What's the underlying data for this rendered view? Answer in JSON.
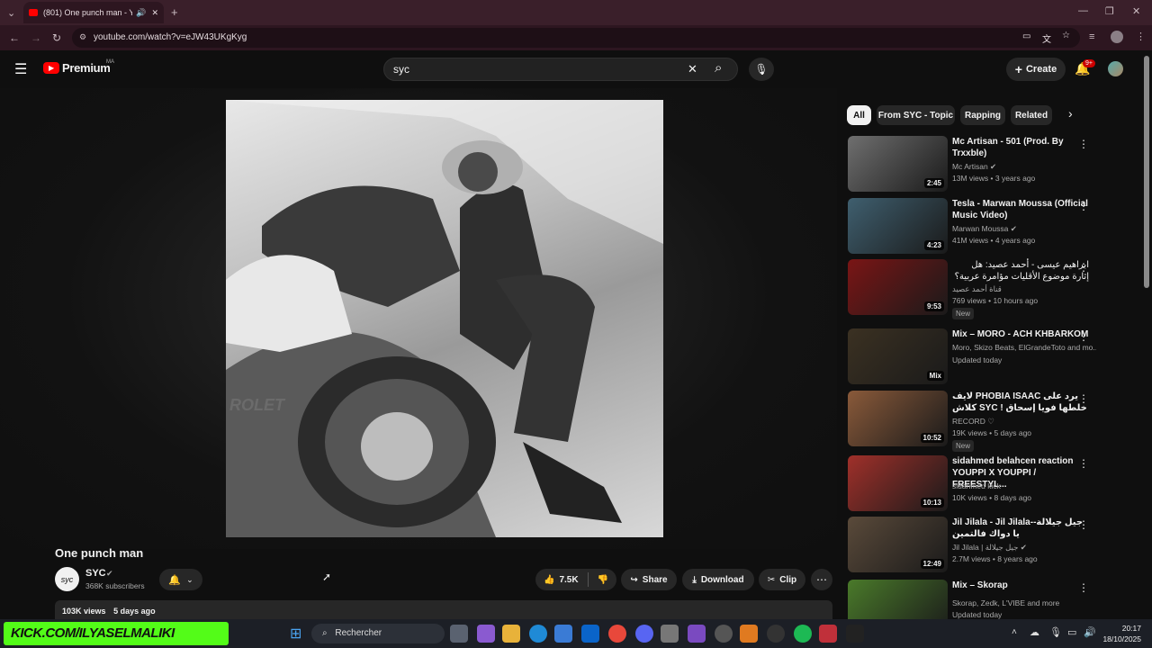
{
  "browser": {
    "tab_title": "(801) One punch man - You",
    "url": "youtube.com/watch?v=eJW43UKgKyg"
  },
  "header": {
    "logo_text": "Premium",
    "region": "MA",
    "search_value": "syc",
    "create_label": "Create",
    "notif_badge": "9+"
  },
  "video": {
    "title": "One punch man",
    "channel": "SYC",
    "subscribers": "368K subscribers",
    "likes": "7.5K",
    "share_label": "Share",
    "download_label": "Download",
    "clip_label": "Clip",
    "views": "103K views",
    "age": "5 days ago",
    "frame_text": "ROLET"
  },
  "chips": [
    "All",
    "From SYC - Topic",
    "Rapping",
    "Related"
  ],
  "recommendations": [
    {
      "title": "Mc Artisan - 501 (Prod. By Trxxble)",
      "channel": "Mc Artisan",
      "verified": true,
      "meta": "13M views • 3 years ago",
      "duration": "2:45",
      "color": "#6f6f6f",
      "new": ""
    },
    {
      "title": "Tesla - Marwan Moussa (Official Music Video)",
      "channel": "Marwan Moussa",
      "verified": true,
      "meta": "41M views • 4 years ago",
      "duration": "4:23",
      "color": "#3f5f6f",
      "new": ""
    },
    {
      "title": "ابراهيم عيسى - أحمد عصيد: هل إثارة موضوع الأقليات مؤامرة عربية؟",
      "channel": "قناة أحمد عصيد",
      "verified": false,
      "meta": "769 views • 10 hours ago",
      "duration": "9:53",
      "color": "#7a1515",
      "new": "New"
    },
    {
      "title": "Mix – MORO - ACH KHBARKOM",
      "channel": "Moro, Skizo Beats, ElGrandeToto and mo...",
      "verified": false,
      "meta": "Updated today",
      "duration": "Mix",
      "color": "#3b3122",
      "new": ""
    },
    {
      "title": "لايف PHOBIA ISAAC يرد على كلاش SYC ! خلطها فويا إسحاق",
      "channel": "RECORD ♡",
      "verified": false,
      "meta": "19K views • 5 days ago",
      "duration": "10:52",
      "color": "#8a5a3a",
      "new": "New"
    },
    {
      "title": "sidahmed belahcen reaction YOUPPI X YOUPPI / FREESTYL...",
      "channel": "sidahmed kick",
      "verified": false,
      "meta": "10K views • 8 days ago",
      "duration": "10:13",
      "color": "#a0302a",
      "new": ""
    },
    {
      "title": "Jil Jilala - Jil Jilala-جيل جيلالة-يا دواك فالتمين",
      "channel": "Jil Jilala | جيل جيلالة",
      "verified": true,
      "meta": "2.7M views • 8 years ago",
      "duration": "12:49",
      "color": "#5a4a3a",
      "new": ""
    },
    {
      "title": "Mix – Skorap",
      "channel": "Skorap, Zedk, L'VIBE and more",
      "verified": false,
      "meta": "Updated today",
      "duration": "",
      "color": "#4a7a2a",
      "new": ""
    }
  ],
  "taskbar": {
    "banner": "KICK.COM/ILYASELMALIKI",
    "search_label": "Rechercher",
    "time": "20:17",
    "date": "18/10/2025"
  }
}
